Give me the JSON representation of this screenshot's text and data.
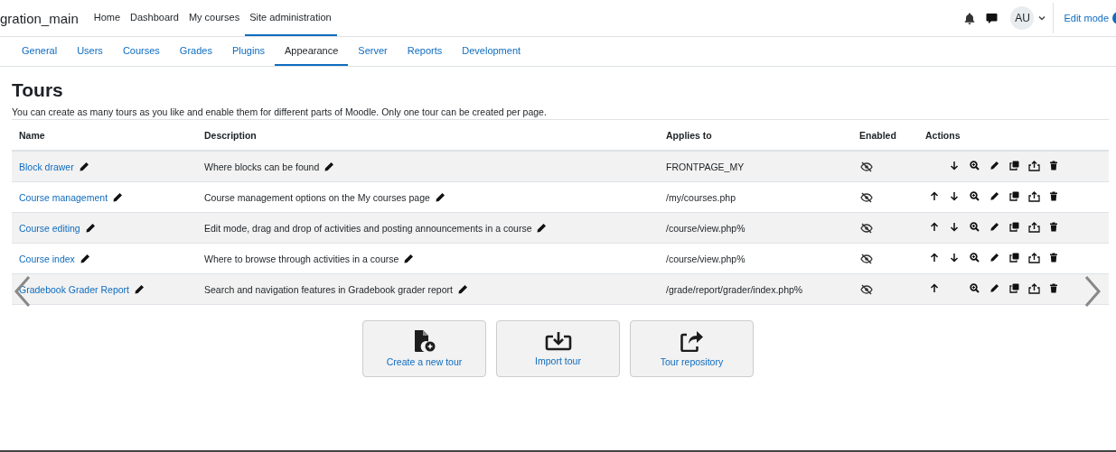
{
  "navbar": {
    "brand": "gration_main",
    "links": [
      {
        "label": "Home",
        "selected": false
      },
      {
        "label": "Dashboard",
        "selected": false
      },
      {
        "label": "My courses",
        "selected": false
      },
      {
        "label": "Site administration",
        "selected": true
      }
    ],
    "avatar": "AU",
    "edit_mode": "Edit mode"
  },
  "tabs": [
    {
      "label": "General",
      "selected": false
    },
    {
      "label": "Users",
      "selected": false
    },
    {
      "label": "Courses",
      "selected": false
    },
    {
      "label": "Grades",
      "selected": false
    },
    {
      "label": "Plugins",
      "selected": false
    },
    {
      "label": "Appearance",
      "selected": true
    },
    {
      "label": "Server",
      "selected": false
    },
    {
      "label": "Reports",
      "selected": false
    },
    {
      "label": "Development",
      "selected": false
    }
  ],
  "page": {
    "title": "Tours",
    "intro": "You can create as many tours as you like and enable them for different parts of Moodle. Only one tour can be created per page."
  },
  "table": {
    "columns": [
      "Name",
      "Description",
      "Applies to",
      "Enabled",
      "Actions"
    ],
    "rows": [
      {
        "name": "Block drawer",
        "description": "Where blocks can be found",
        "applies_to": "FRONTPAGE_MY",
        "enabled": false,
        "can_move_up": false,
        "can_move_down": true
      },
      {
        "name": "Course management",
        "description": "Course management options on the My courses page",
        "applies_to": "/my/courses.php",
        "enabled": false,
        "can_move_up": true,
        "can_move_down": true
      },
      {
        "name": "Course editing",
        "description": "Edit mode, drag and drop of activities and posting announcements in a course",
        "applies_to": "/course/view.php%",
        "enabled": false,
        "can_move_up": true,
        "can_move_down": true
      },
      {
        "name": "Course index",
        "description": "Where to browse through activities in a course",
        "applies_to": "/course/view.php%",
        "enabled": false,
        "can_move_up": true,
        "can_move_down": true
      },
      {
        "name": "Gradebook Grader Report",
        "description": "Search and navigation features in Gradebook grader report",
        "applies_to": "/grade/report/grader/index.php%",
        "enabled": false,
        "can_move_up": true,
        "can_move_down": false
      }
    ]
  },
  "actions": [
    {
      "kind": "create",
      "label": "Create a new tour"
    },
    {
      "kind": "import",
      "label": "Import tour"
    },
    {
      "kind": "repository",
      "label": "Tour repository"
    }
  ]
}
